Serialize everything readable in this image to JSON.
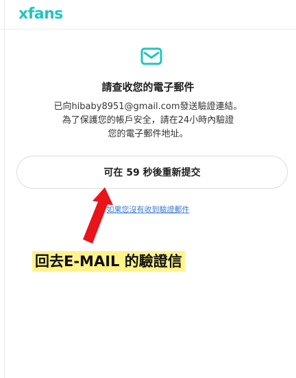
{
  "header": {
    "logo_text": "xfans"
  },
  "verify": {
    "title": "請查收您的電子郵件",
    "message_lines": [
      "已向hibaby8951@gmail.com發送驗證連結。",
      "為了保護您的帳戶安全，請在24小時內驗證",
      "您的電子郵件地址。"
    ],
    "resend_button_label": "可在 59 秒後重新提交",
    "help_link_text": "如果您沒有收到驗證郵件"
  },
  "annotation": {
    "text": "回去E-MAIL 的驗證信",
    "highlight_color": "#fff38a",
    "arrow_color": "#e8141a"
  },
  "colors": {
    "brand": "#1fc6c0",
    "link": "#3a7bd5"
  },
  "icons": {
    "mail": "envelope-icon"
  }
}
